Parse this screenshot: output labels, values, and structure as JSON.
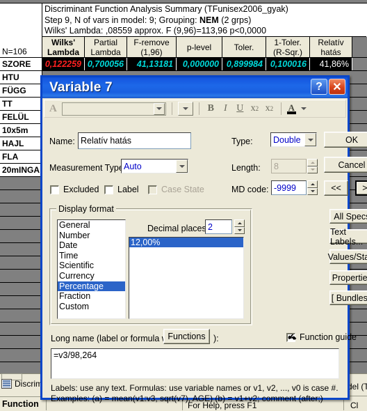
{
  "background": {
    "report": {
      "line1": "Discriminant Function Analysis Summary (TFunisex2006_gyak)",
      "line2_a": "Step 9, N of vars in model: 9; Grouping: ",
      "line2_b": "NEM",
      "line2_c": " (2 grps)",
      "line3": "Wilks' Lambda: ,08559 approx. F (9,96)=113,96 p<0,0000"
    },
    "n_label": "N=106",
    "columns": [
      {
        "l1": "Wilks'",
        "l2": "Lambda",
        "bold": true
      },
      {
        "l1": "Partial",
        "l2": "Lambda",
        "bold": false
      },
      {
        "l1": "F-remove",
        "l2": "(1,96)",
        "bold": false
      },
      {
        "l1": "p-level",
        "l2": "",
        "bold": false
      },
      {
        "l1": "Toler.",
        "l2": "",
        "bold": false
      },
      {
        "l1": "1-Toler.",
        "l2": "(R-Sqr.)",
        "bold": false
      },
      {
        "l1": "Relatív",
        "l2": "hatás",
        "bold": false
      }
    ],
    "data_row": {
      "label": "SZORE",
      "values": [
        "0,122259",
        "0,700056",
        "41,13181",
        "0,000000",
        "0,899984",
        "0,100016",
        "41,86%"
      ],
      "first_color": "#ff2020",
      "value_color": "#00d8d8",
      "last_color": "#ffffff"
    },
    "row_labels": [
      "HTU",
      "FÜGG",
      "TT",
      "FELÜL",
      "10x5m",
      "HAJL",
      "FLA",
      "20mINGA"
    ],
    "status": {
      "tab_label": "Discrimi",
      "function_label": "Function",
      "right_text": "del (T",
      "help_text": "For Help, press F1",
      "corner_text": "Cl"
    }
  },
  "dialog": {
    "title": "Variable 7",
    "titlebar_buttons": [
      {
        "name": "help-button",
        "glyph": "?"
      },
      {
        "name": "close-button",
        "glyph": "✕"
      }
    ],
    "format_toolbar": {
      "font_A": "A",
      "font_value": "",
      "size_value": "",
      "bold": "B",
      "italic": "I",
      "underline": "U",
      "subscript_base": "x",
      "subscript_idx": "2",
      "superscript_base": "x",
      "superscript_idx": "2",
      "color_A": "A"
    },
    "name_label": "Name:",
    "name_value": "Relatív hatás",
    "type_label": "Type:",
    "type_value": "Double",
    "measurement_label": "Measurement Type:",
    "measurement_value": "Auto",
    "length_label": "Length:",
    "length_value": "8",
    "excluded_label": "Excluded",
    "excluded_checked": false,
    "label_label": "Label",
    "label_checked": false,
    "case_state_label": "Case State",
    "case_state_checked": false,
    "md_code_label": "MD code:",
    "md_code_value": "-9999",
    "buttons": {
      "ok": "OK",
      "cancel": "Cancel",
      "prev": "<<",
      "next": ">>",
      "all_specs": "All Specs...",
      "text_labels": "Text Labels...",
      "values_stats": "Values/Stats...",
      "properties": "Properties...",
      "bundles": "[ Bundles ]...",
      "functions": "Functions"
    },
    "display_format": {
      "group_label": "Display format",
      "items": [
        "General",
        "Number",
        "Date",
        "Time",
        "Scientific",
        "Currency",
        "Percentage",
        "Fraction",
        "Custom"
      ],
      "selected": "Percentage",
      "decimal_places_label": "Decimal places:",
      "decimal_places_value": "2",
      "preview_value": "12,00%"
    },
    "long_name_label_a": "Long name (label or formula with",
    "long_name_label_b": "):",
    "function_guide_label": "Function guide",
    "function_guide_checked": true,
    "formula_value": "=v3/98,264",
    "hint_line1": "Labels: use any text.  Formulas: use variable names or v1, v2, ..., v0 is case #.",
    "hint_line2": "Examples:   (a) = mean(v1:v3, sqrt(v7), AGE)   (b) = v1+v2; comment (after;)"
  }
}
